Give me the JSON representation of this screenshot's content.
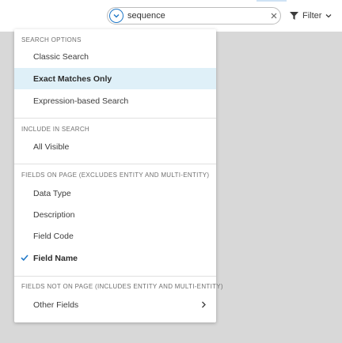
{
  "search": {
    "value": "sequence"
  },
  "filter": {
    "label": "Filter"
  },
  "menu": {
    "sections": [
      {
        "title": "SEARCH OPTIONS",
        "items": [
          {
            "label": "Classic Search"
          },
          {
            "label": "Exact Matches Only",
            "selected": true
          },
          {
            "label": "Expression-based Search"
          }
        ]
      },
      {
        "title": "INCLUDE IN SEARCH",
        "items": [
          {
            "label": "All Visible"
          }
        ]
      },
      {
        "title": "FIELDS ON PAGE (EXCLUDES ENTITY AND MULTI-ENTITY)",
        "items": [
          {
            "label": "Data Type"
          },
          {
            "label": "Description"
          },
          {
            "label": "Field Code"
          },
          {
            "label": "Field Name",
            "checked": true
          }
        ]
      },
      {
        "title": "FIELDS NOT ON PAGE (INCLUDES ENTITY AND MULTI-ENTITY)",
        "items": [
          {
            "label": "Other Fields",
            "submenu": true
          }
        ]
      }
    ]
  },
  "colors": {
    "accent": "#1f78c8",
    "selected_bg": "#dff0f8",
    "backdrop": "#d8d8d8"
  },
  "icons": {
    "search_toggle": "chevron-down-icon",
    "clear": "close-icon",
    "filter": "funnel-icon",
    "filter_caret": "chevron-down-icon",
    "checked": "check-icon",
    "submenu": "chevron-right-icon"
  }
}
